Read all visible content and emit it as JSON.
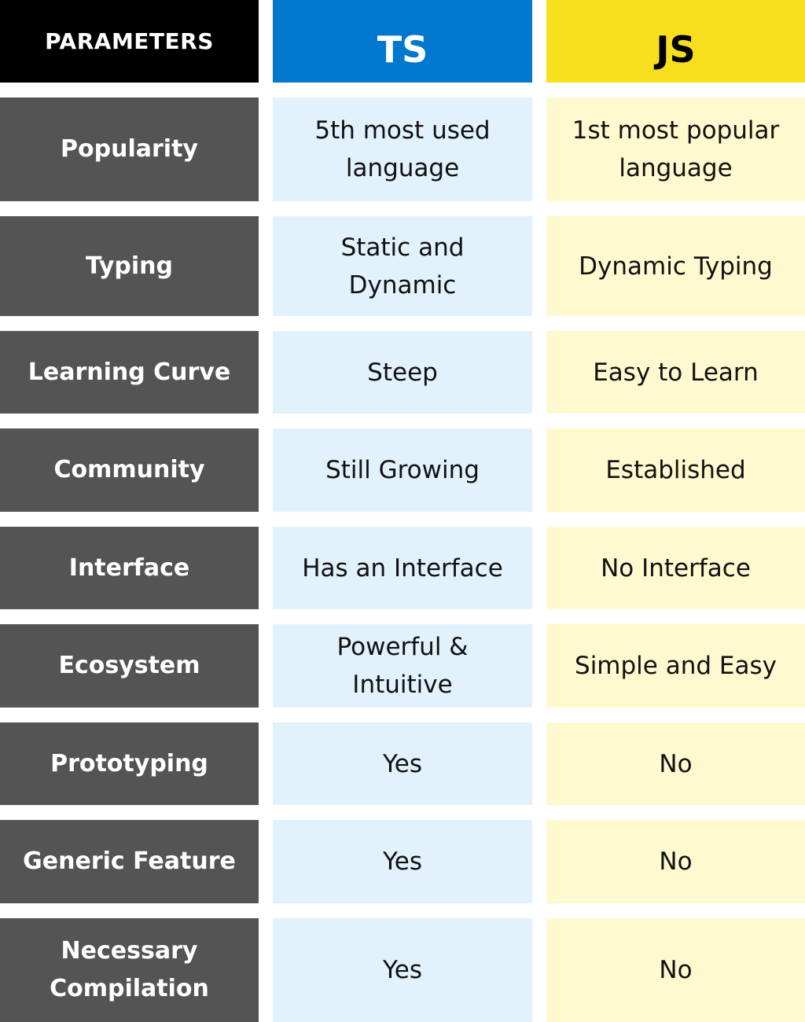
{
  "header": {
    "parameters": "PARAMETERS",
    "ts": "TS",
    "js": "JS"
  },
  "colors": {
    "header_parameters": "#000000",
    "ts": "#0078cd",
    "js": "#f7df1e",
    "parameter_cell": "#545454",
    "ts_cell": "#e2f2fc",
    "js_cell": "#fff9d0"
  },
  "rows": [
    {
      "parameter": "Popularity",
      "ts": "5th most used language",
      "js": "1st most popular language"
    },
    {
      "parameter": "Typing",
      "ts": "Static and Dynamic",
      "js": "Dynamic Typing"
    },
    {
      "parameter": "Learning Curve",
      "ts": "Steep",
      "js": "Easy to Learn"
    },
    {
      "parameter": "Community",
      "ts": "Still Growing",
      "js": "Established"
    },
    {
      "parameter": "Interface",
      "ts": "Has an Interface",
      "js": "No Interface"
    },
    {
      "parameter": "Ecosystem",
      "ts": "Powerful & Intuitive",
      "js": "Simple and Easy"
    },
    {
      "parameter": "Prototyping",
      "ts": "Yes",
      "js": "No"
    },
    {
      "parameter": "Generic Feature",
      "ts": "Yes",
      "js": "No"
    },
    {
      "parameter": "Necessary Compilation",
      "ts": "Yes",
      "js": "No"
    }
  ]
}
